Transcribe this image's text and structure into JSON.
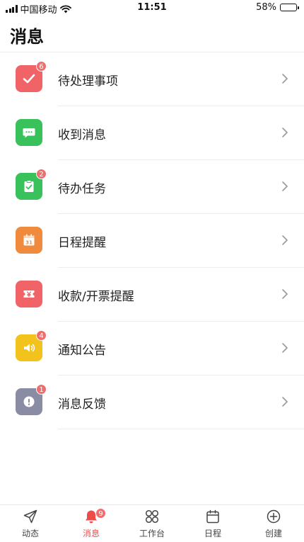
{
  "status_bar": {
    "carrier": "中国移动",
    "time": "11:51",
    "battery_text": "58%",
    "battery_level": 0.58
  },
  "header": {
    "title": "消息"
  },
  "list": [
    {
      "label": "待处理事项",
      "icon": "check-icon",
      "color": "#f06468",
      "badge": "6"
    },
    {
      "label": "收到消息",
      "icon": "chat-bubble-icon",
      "color": "#39c25c",
      "badge": ""
    },
    {
      "label": "待办任务",
      "icon": "clipboard-check-icon",
      "color": "#39c25c",
      "badge": "2"
    },
    {
      "label": "日程提醒",
      "icon": "calendar-icon",
      "color": "#f08a3c",
      "badge": ""
    },
    {
      "label": "收款/开票提醒",
      "icon": "ticket-yen-icon",
      "color": "#f06468",
      "badge": ""
    },
    {
      "label": "通知公告",
      "icon": "speaker-icon",
      "color": "#f2c31c",
      "badge": "4"
    },
    {
      "label": "消息反馈",
      "icon": "alert-icon",
      "color": "#8a8ca3",
      "badge": "1"
    }
  ],
  "tabbar": {
    "tabs": [
      {
        "label": "动态",
        "icon": "send-icon",
        "active": false,
        "badge": ""
      },
      {
        "label": "消息",
        "icon": "bell-icon",
        "active": true,
        "badge": "9"
      },
      {
        "label": "工作台",
        "icon": "grid-icon",
        "active": false,
        "badge": ""
      },
      {
        "label": "日程",
        "icon": "calendar-outline-icon",
        "active": false,
        "badge": ""
      },
      {
        "label": "创建",
        "icon": "plus-circle-icon",
        "active": false,
        "badge": ""
      }
    ],
    "active_color": "#ee4b4b"
  }
}
